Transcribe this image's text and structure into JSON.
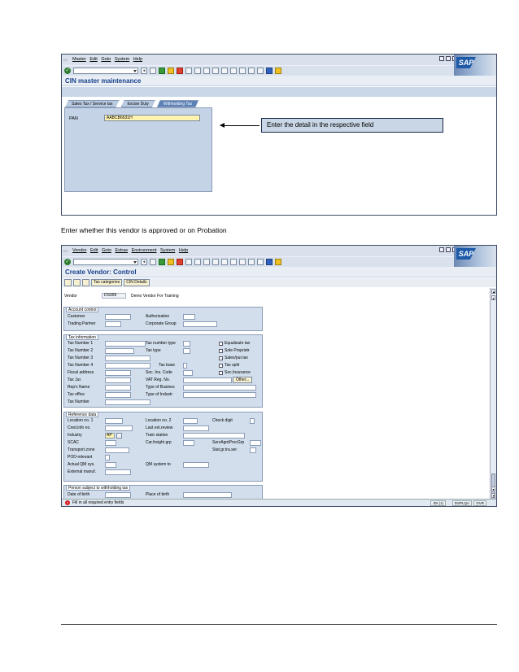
{
  "screen1": {
    "menu": [
      "Master",
      "Edit",
      "Goto",
      "System",
      "Help"
    ],
    "title": "CIN master maintenance",
    "tabs": [
      "Sales Tax / Service tax",
      "Excise Duty",
      "Withholding Tax"
    ],
    "pan_label": "PAN",
    "pan_value": "AABCB6631H",
    "callout": "Enter the detail in the respective field"
  },
  "caption": "Enter whether this vendor is approved or on Probation",
  "screen2": {
    "menu": [
      "Vendor",
      "Edit",
      "Goto",
      "Extras",
      "Environment",
      "System",
      "Help"
    ],
    "title": "Create Vendor: Control",
    "appbar": [
      "Tax categories",
      "CIN Details"
    ],
    "vendor_label": "Vendor",
    "vendor_value": "DS999",
    "vendor_name": "Demo Vendor For Training",
    "account_control": {
      "title": "Account control",
      "customer": "Customer",
      "authorization": "Authorization",
      "trading_partner": "Trading Partner",
      "corporate_group": "Corporate Group"
    },
    "tax_information": {
      "title": "Tax information",
      "tax1": "Tax Number 1",
      "tax2": "Tax Number 2",
      "tax3": "Tax Number 3",
      "tax4": "Tax Number 4",
      "fiscal": "Fiscal address",
      "taxjur": "Tax Jur.",
      "reps": "Rep's Name",
      "taxoffice": "Tax office",
      "taxnumber": "Tax Number",
      "tnt": "Tax number type",
      "taxtype": "Tax type",
      "taxbase": "Tax base",
      "socins": "Soc. Ins. Code",
      "vatreg": "VAT Reg. No.",
      "typebus": "Type of Busines",
      "typeind": "Type of Industr",
      "equal": "Equalizatn tax",
      "sole": "Sole Proprietr",
      "sales": "Sales/pur.tax",
      "split": "Tax split",
      "socins_cb": "Soc.Insurance",
      "other": "Other..."
    },
    "reference": {
      "title": "Reference data",
      "loc1": "Location no. 1",
      "credinfo": "Cred.info no.",
      "industry": "Industry",
      "industry_value": "AP",
      "scac": "SCAC",
      "transport": "Transport.zone",
      "pod": "POD-relevant",
      "actualqm": "Actual QM sys.",
      "extmanuf": "External manuf.",
      "loc2": "Location no. 2",
      "lastext": "Last ext.review",
      "train": "Train station",
      "carfreight": "Car.freight grp",
      "qmsystem": "QM system to",
      "checkdigit": "Check digit",
      "servagt": "ServAgntProcGrp",
      "statgr": "Stat.gr.tra.ser"
    },
    "person": {
      "title": "Person subject to withholding tax",
      "dob": "Date of birth",
      "pob": "Place of birth"
    },
    "status": {
      "message": "Fill in all required entry fields",
      "server": "IDI (1)",
      "client": "DSPLQA",
      "mode": "OVR"
    }
  }
}
